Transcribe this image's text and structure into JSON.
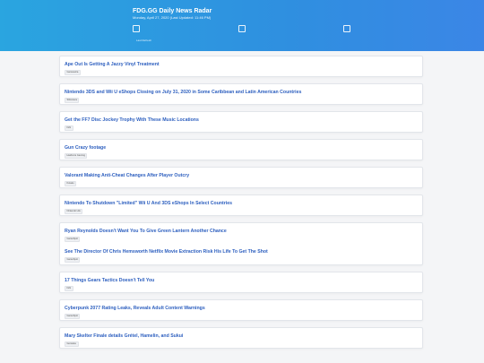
{
  "header": {
    "title": "FDG.GG Daily News Radar",
    "subtitle": "Monday, April 27, 2020 (Last Updated: 11:46 PM)",
    "small_text": "Last Refresh"
  },
  "articles": [
    {
      "title": "Ape Out Is Getting A Jazzy Vinyl Treatment",
      "source": "Gamasutra"
    },
    {
      "title": "Nintendo 3DS and Wii U eShops Closing on July 31, 2020 in Some Caribbean and Latin American Countries",
      "source": "Siliconera"
    },
    {
      "title": "Get the FF7 Disc Jockey Trophy With These Music Locations",
      "source": "IGN"
    },
    {
      "title": "Gun Crazy footage",
      "source": "Hardcore Gaming"
    },
    {
      "title": "Valorant Making Anti-Cheat Changes After Player Outcry",
      "source": "Kotaku"
    },
    {
      "title": "Nintendo To Shutdown \"Limited\" Wii U And 3DS eShops In Select Countries",
      "source": "Nintendo Life"
    },
    {
      "title": "Ryan Reynolds Doesn't Want You To Give Green Lantern Another Chance",
      "source": "GameSpot"
    },
    {
      "title": "See The Director Of Chris Hemsworth Netflix Movie Extraction Risk His Life To Get The Shot",
      "source": "GameSpot"
    },
    {
      "title": "17 Things Gears Tactics Doesn't Tell You",
      "source": "IGN"
    },
    {
      "title": "Cyberpunk 2077 Rating Leaks, Reveals Adult Content Warnings",
      "source": "GameSpot"
    },
    {
      "title": "Mary Skelter Finale details Grétel, Hamelin, and Sukui",
      "source": "Gematsu"
    }
  ],
  "colors": {
    "header_start": "#2aa5e0",
    "header_end": "#3b86e6",
    "link": "#2d5fbf"
  }
}
